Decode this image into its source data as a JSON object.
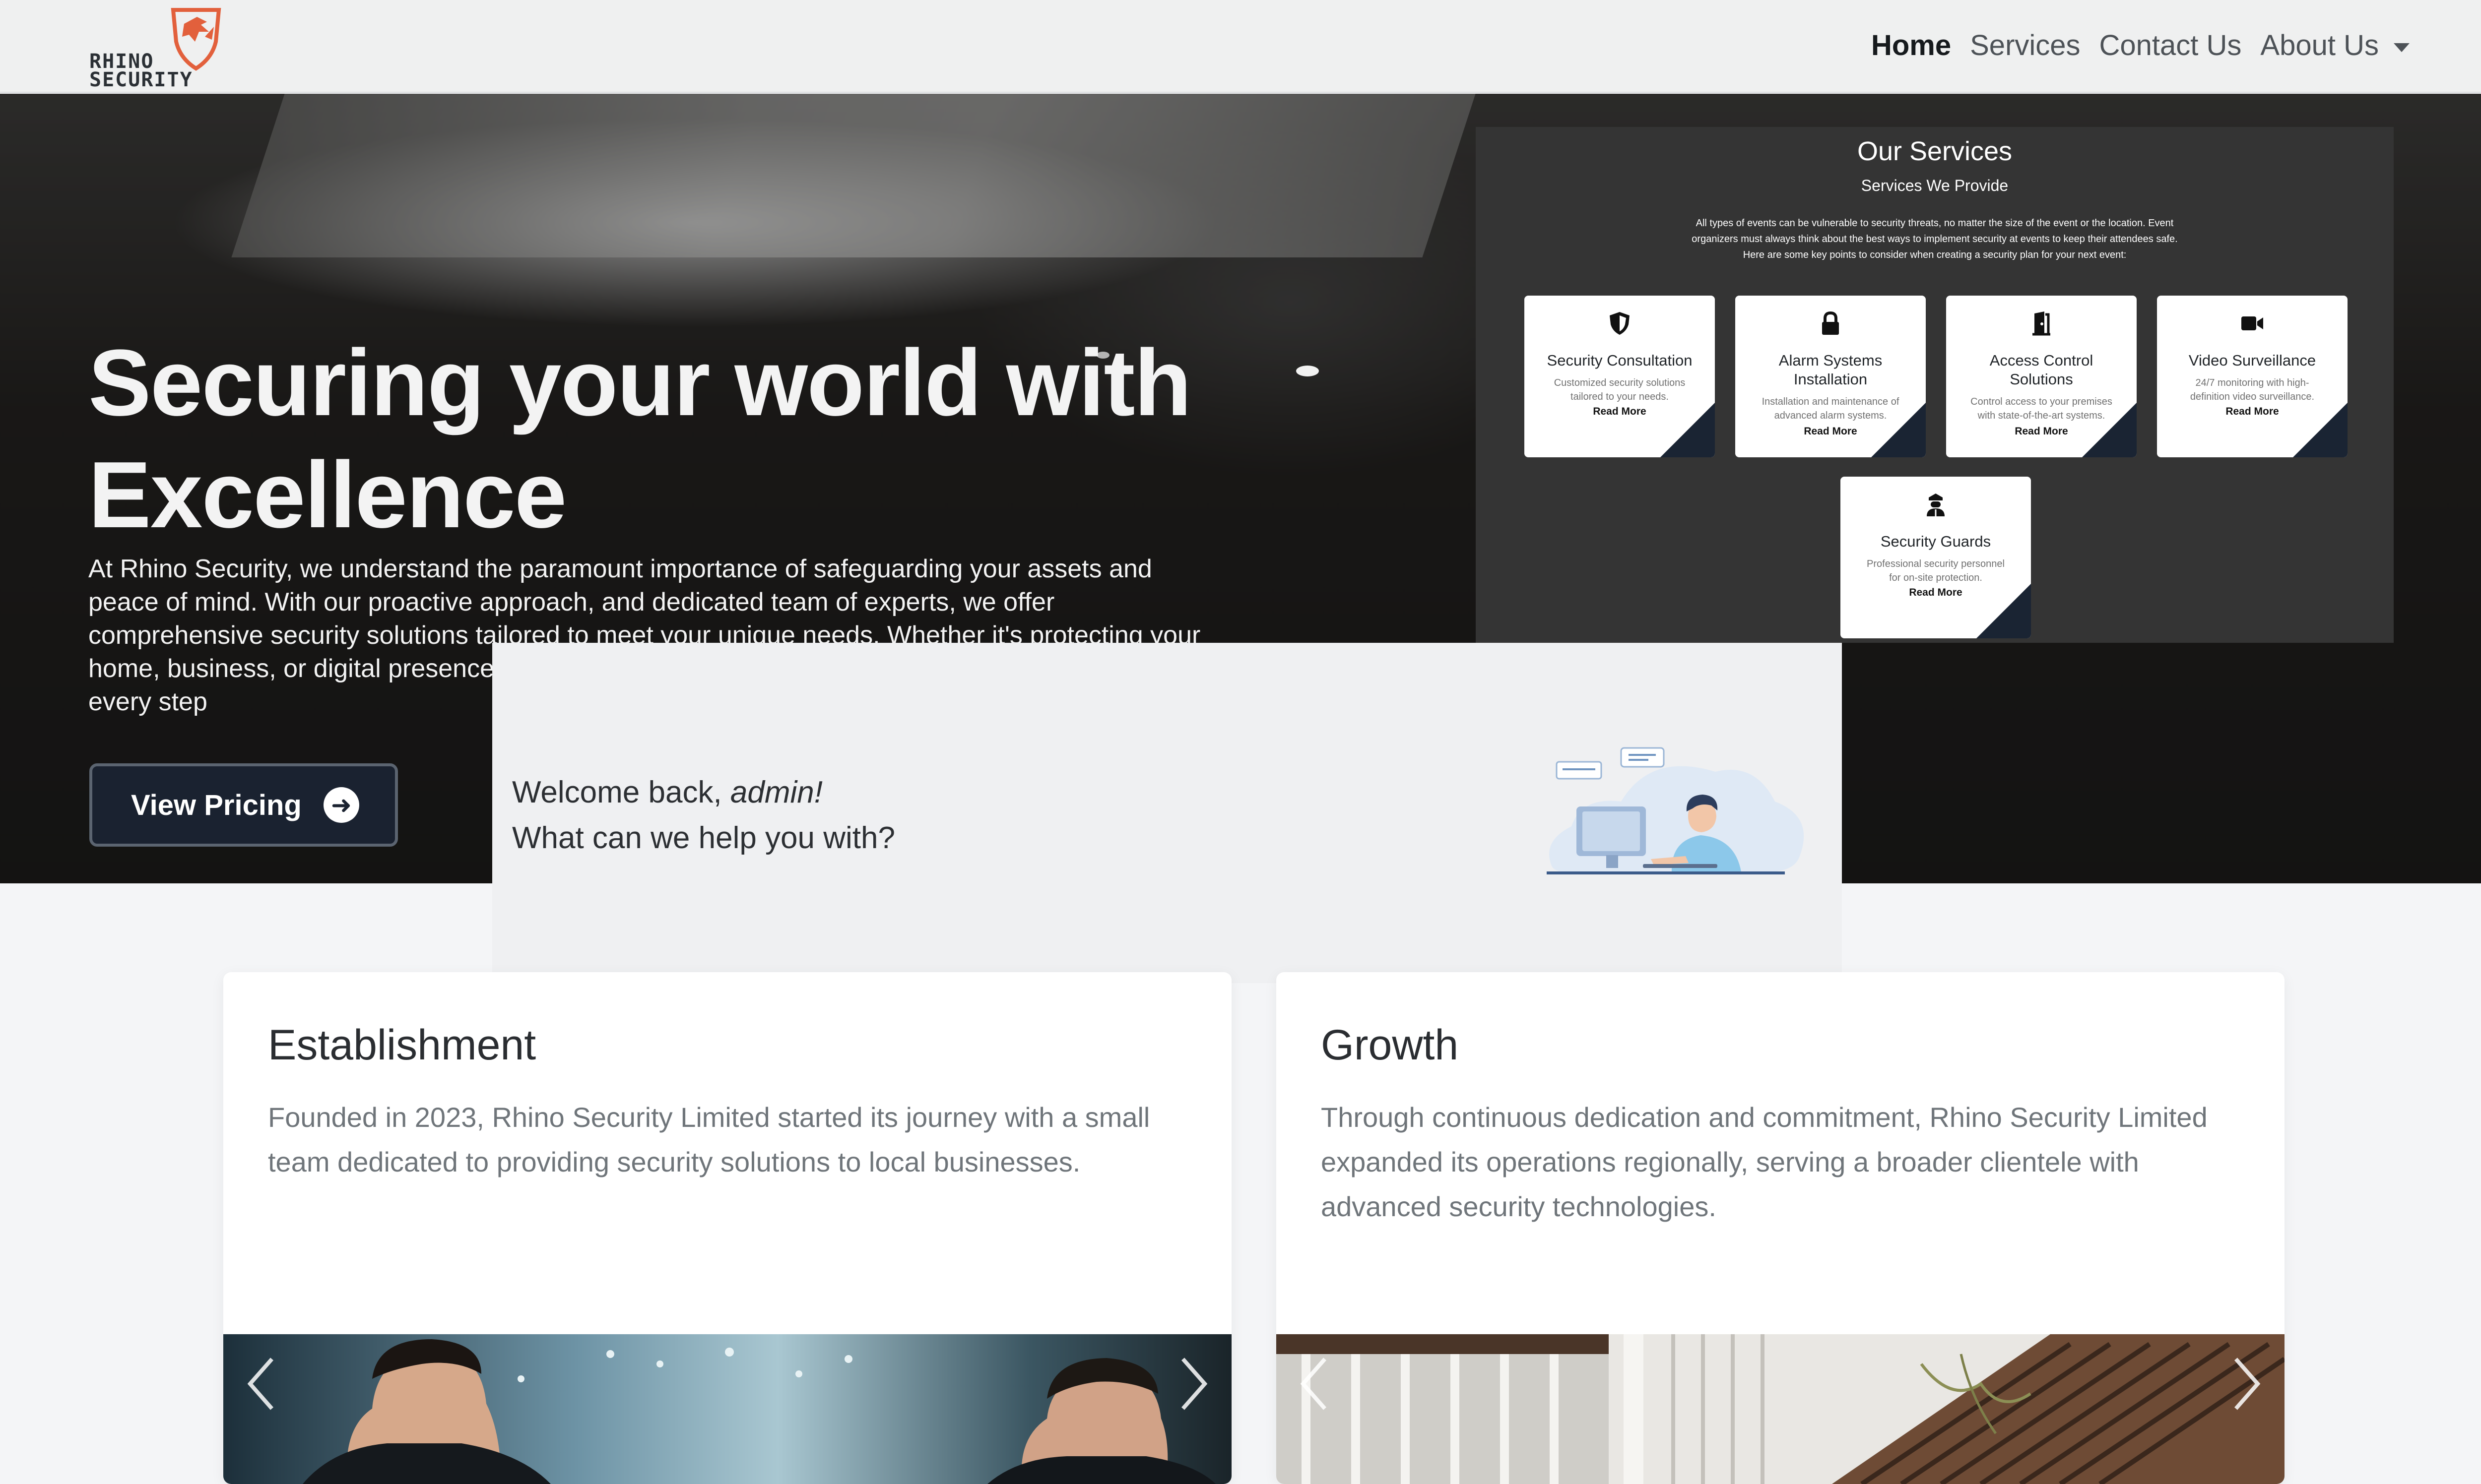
{
  "brand": {
    "logo_line1": "RHINO",
    "logo_line2": "SECURITY",
    "accent": "#e2603c"
  },
  "nav": {
    "home": "Home",
    "services": "Services",
    "contact": "Contact Us",
    "about": "About Us"
  },
  "hero": {
    "title_line1": "Securing your world with",
    "title_line2": "Excellence",
    "description": "At Rhino Security, we understand the paramount importance of safeguarding your assets and peace of mind. With our proactive approach, and dedicated team of experts, we offer comprehensive security solutions tailored to meet your unique needs. Whether it's protecting your home, business, or digital presence, trust us to be your partner in ensuring safety and security at every step",
    "cta_label": "View Pricing"
  },
  "services": {
    "title": "Our Services",
    "subtitle": "Services We Provide",
    "description_line1": "All types of events can be vulnerable to security threats, no matter the size of the event or the location. Event",
    "description_line2": "organizers must always think about the best ways to implement security at events to keep their attendees safe.",
    "description_line3": "Here are some key points to consider when creating a security plan for your next event:",
    "read_more": "Read More",
    "items": [
      {
        "name": "Security Consultation",
        "desc": "Customized security solutions tailored to your needs.",
        "icon": "shield-icon"
      },
      {
        "name": "Alarm Systems Installation",
        "desc": "Installation and maintenance of advanced alarm systems.",
        "icon": "lock-icon"
      },
      {
        "name": "Access Control Solutions",
        "desc": "Control access to your premises with state-of-the-art systems.",
        "icon": "door-icon"
      },
      {
        "name": "Video Surveillance",
        "desc": "24/7 monitoring with high-definition video surveillance.",
        "icon": "video-camera-icon"
      },
      {
        "name": "Security Guards",
        "desc": "Professional security personnel for on-site protection.",
        "icon": "guard-icon"
      }
    ]
  },
  "welcome": {
    "prefix": "Welcome back,",
    "username": "admin!",
    "question": "What can we help you with?"
  },
  "timeline": [
    {
      "title": "Establishment",
      "text": "Founded in 2023, Rhino Security Limited started its journey with a small team dedicated to providing security solutions to local businesses."
    },
    {
      "title": "Growth",
      "text": "Through continuous dedication and commitment, Rhino Security Limited expanded its operations regionally, serving a broader clientele with advanced security technologies."
    }
  ],
  "carousel": {
    "prev_icon": "chevron-left-icon",
    "next_icon": "chevron-right-icon"
  }
}
